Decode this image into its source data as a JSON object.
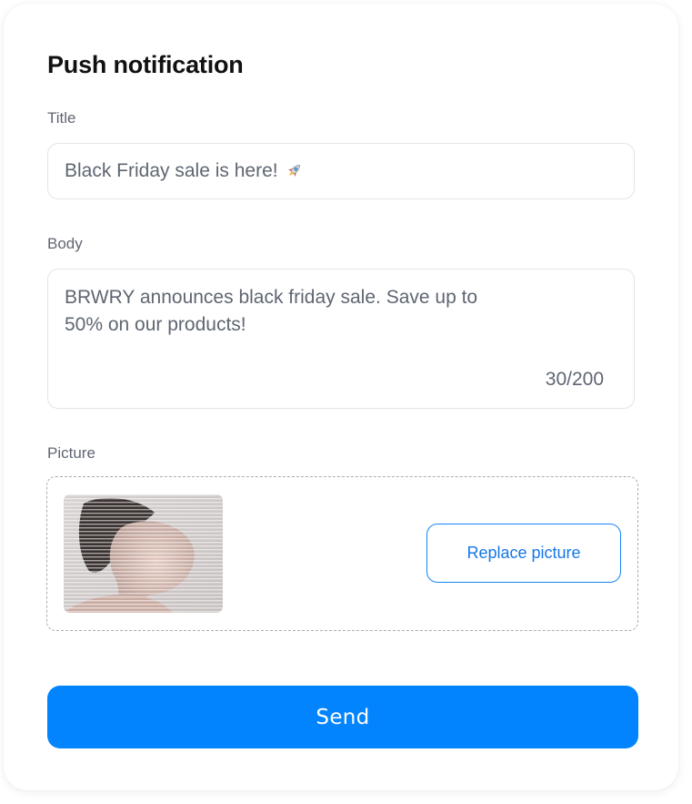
{
  "card": {
    "heading": "Push notification"
  },
  "title_field": {
    "label": "Title",
    "value": "Black Friday sale is here!",
    "emoji_icon": "rocket-icon"
  },
  "body_field": {
    "label": "Body",
    "value": "BRWRY announces black friday sale. Save up to 50% on our products!",
    "counter": "30/200"
  },
  "picture_field": {
    "label": "Picture",
    "thumbnail": "woman-profile-photo",
    "replace_label": "Replace picture"
  },
  "actions": {
    "send_label": "Send"
  },
  "colors": {
    "accent": "#0284ff",
    "label_gray": "#5f6672",
    "border": "#e3e5e8",
    "dashed_border": "#a9adb3"
  }
}
